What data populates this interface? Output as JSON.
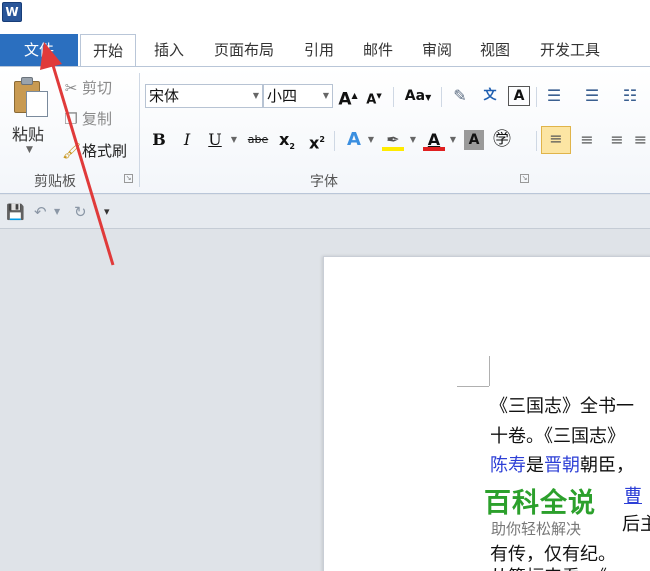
{
  "app": {
    "logo_letter": "W"
  },
  "tabs": [
    {
      "label": "文件"
    },
    {
      "label": "开始"
    },
    {
      "label": "插入"
    },
    {
      "label": "页面布局"
    },
    {
      "label": "引用"
    },
    {
      "label": "邮件"
    },
    {
      "label": "审阅"
    },
    {
      "label": "视图"
    },
    {
      "label": "开发工具"
    }
  ],
  "clipboard": {
    "paste_label": "粘贴",
    "cut_label": "剪切",
    "copy_label": "复制",
    "format_painter_label": "格式刷",
    "group_label": "剪贴板"
  },
  "font": {
    "font_name": "宋体",
    "font_size": "小四",
    "grow_label": "A",
    "shrink_label": "A",
    "case_label": "Aa",
    "bold": "B",
    "italic": "I",
    "underline": "U",
    "strike": "abe",
    "subscript": "x",
    "superscript": "x",
    "group_label": "字体"
  },
  "doc": {
    "line1": "《三国志》全书一",
    "line2": "十卷。《三国志》",
    "line3_link1": "陈寿",
    "line3_mid": "是",
    "line3_link2": "晋朝",
    "line3_rest": "朝臣，",
    "line4_link": "曹",
    "line5": "后主",
    "line6": "有传，仅有纪。",
    "line7": "从篇幅来看，《"
  },
  "watermark": {
    "title": "百科全说",
    "subtitle": "助你轻松解决"
  },
  "colors": {
    "file_tab": "#2b6fbf",
    "arrow": "#e03a3a",
    "watermark": "#2ca02c",
    "link": "#2d3fd6"
  }
}
